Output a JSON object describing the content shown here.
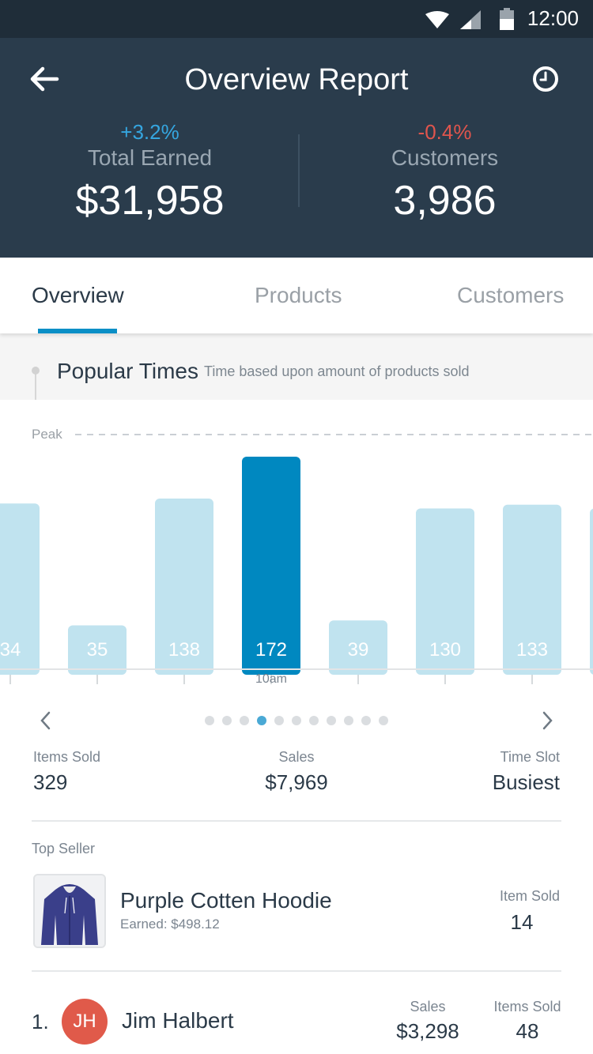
{
  "status_bar": {
    "time": "12:00"
  },
  "header": {
    "title": "Overview Report",
    "stats": [
      {
        "change": "+3.2%",
        "label": "Total Earned",
        "value": "$31,958",
        "change_color": "#35a6e0"
      },
      {
        "change": "-0.4%",
        "label": "Customers",
        "value": "3,986",
        "change_color": "#e0554d"
      }
    ]
  },
  "tabs": [
    {
      "label": "Overview",
      "active": true
    },
    {
      "label": "Products",
      "active": false
    },
    {
      "label": "Customers",
      "active": false
    }
  ],
  "section": {
    "title": "Popular Times",
    "subtitle": "Time based upon amount of products sold"
  },
  "chart_data": {
    "type": "bar",
    "peak_label": "Peak",
    "values": [
      134,
      35,
      138,
      172,
      39,
      130,
      133,
      130
    ],
    "value_labels": [
      "34",
      "35",
      "138",
      "172",
      "39",
      "130",
      "133",
      ""
    ],
    "highlight_index": 3,
    "highlight_label": "10am",
    "colors": {
      "bar": "#c0e3ef",
      "highlight": "#0088c0"
    }
  },
  "pager": {
    "count": 11,
    "active": 3
  },
  "metrics": {
    "items_sold": {
      "label": "Items Sold",
      "value": "329"
    },
    "sales": {
      "label": "Sales",
      "value": "$7,969"
    },
    "time_slot": {
      "label": "Time Slot",
      "value": "Busiest"
    }
  },
  "top_seller": {
    "label": "Top Seller",
    "product": "Purple Cotten Hoodie",
    "earned": "Earned: $498.12",
    "sold_label": "Item Sold",
    "sold_value": "14"
  },
  "customers": [
    {
      "rank": "1.",
      "initials": "JH",
      "name": "Jim Halbert",
      "sales_label": "Sales",
      "sales": "$3,298",
      "items_label": "Items Sold",
      "items": "48"
    }
  ]
}
